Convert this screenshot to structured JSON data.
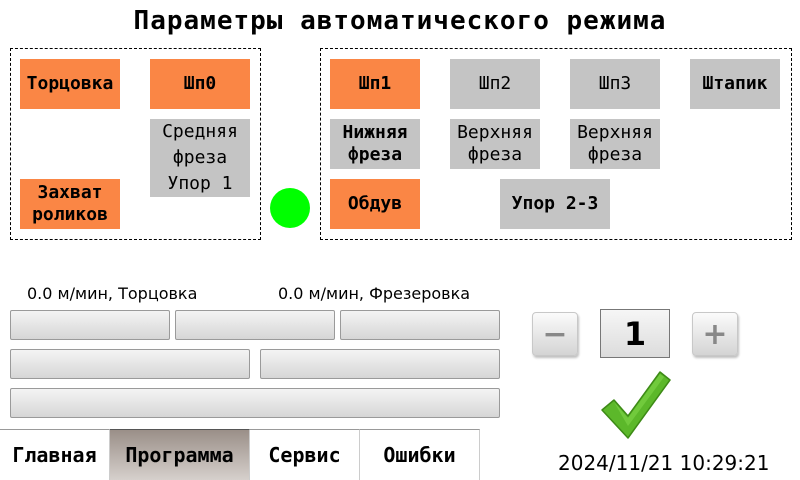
{
  "title": "Параметры автоматического режима",
  "left_panel": {
    "tortsovka": {
      "label": "Торцовка",
      "state": "on"
    },
    "shp0": {
      "label": "Шп0",
      "state": "on"
    },
    "srednyaya_freza_upor1": {
      "label": "Средняя фреза Упор 1",
      "state": "off"
    },
    "zakhvat_rolikov": {
      "label": "Захват роликов",
      "state": "on"
    }
  },
  "indicator": {
    "color": "#00ff00"
  },
  "right_panel": {
    "shp1": {
      "label": "Шп1",
      "state": "on"
    },
    "shp2": {
      "label": "Шп2",
      "state": "off"
    },
    "shp3": {
      "label": "Шп3",
      "state": "off"
    },
    "shtapik": {
      "label": "Штапик",
      "state": "off"
    },
    "nizhnyaya_freza": {
      "label": "Нижняя фреза",
      "state": "off"
    },
    "verkhnyaya_freza_1": {
      "label": "Верхняя фреза",
      "state": "off"
    },
    "verkhnyaya_freza_2": {
      "label": "Верхняя фреза",
      "state": "off"
    },
    "obduv": {
      "label": "Обдув",
      "state": "on"
    },
    "upor23": {
      "label": "Упор 2-3",
      "state": "off"
    }
  },
  "speeds": {
    "tortsovka": "0.0 м/мин, Торцовка",
    "frezerovka": "0.0 м/мин, Фрезеровка"
  },
  "stepper": {
    "minus": "−",
    "value": "1",
    "plus": "+"
  },
  "confirm": {
    "icon": "checkmark-icon",
    "color": "#5cb82a"
  },
  "tabs": [
    "Главная",
    "Программа",
    "Сервис",
    "Ошибки"
  ],
  "active_tab": "Программа",
  "datetime": "2024/11/21 10:29:21",
  "colors": {
    "on": "#fa8645",
    "off": "#c4c4c4"
  }
}
